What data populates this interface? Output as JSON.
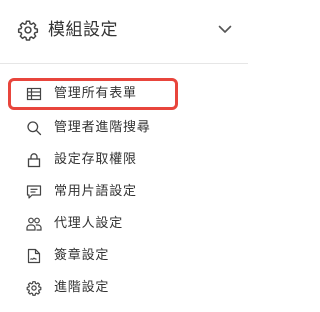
{
  "header": {
    "title": "模組設定",
    "icon": "gear-icon",
    "toggle_icon": "chevron-down-icon"
  },
  "menu": {
    "highlight_color": "#e8453c",
    "items": [
      {
        "label": "管理所有表單",
        "icon": "table-icon",
        "selected": true
      },
      {
        "label": "管理者進階搜尋",
        "icon": "search-icon",
        "selected": false
      },
      {
        "label": "設定存取權限",
        "icon": "lock-icon",
        "selected": false
      },
      {
        "label": "常用片語設定",
        "icon": "comment-icon",
        "selected": false
      },
      {
        "label": "代理人設定",
        "icon": "users-icon",
        "selected": false
      },
      {
        "label": "簽章設定",
        "icon": "signature-icon",
        "selected": false
      },
      {
        "label": "進階設定",
        "icon": "gear-icon",
        "selected": false
      }
    ]
  }
}
